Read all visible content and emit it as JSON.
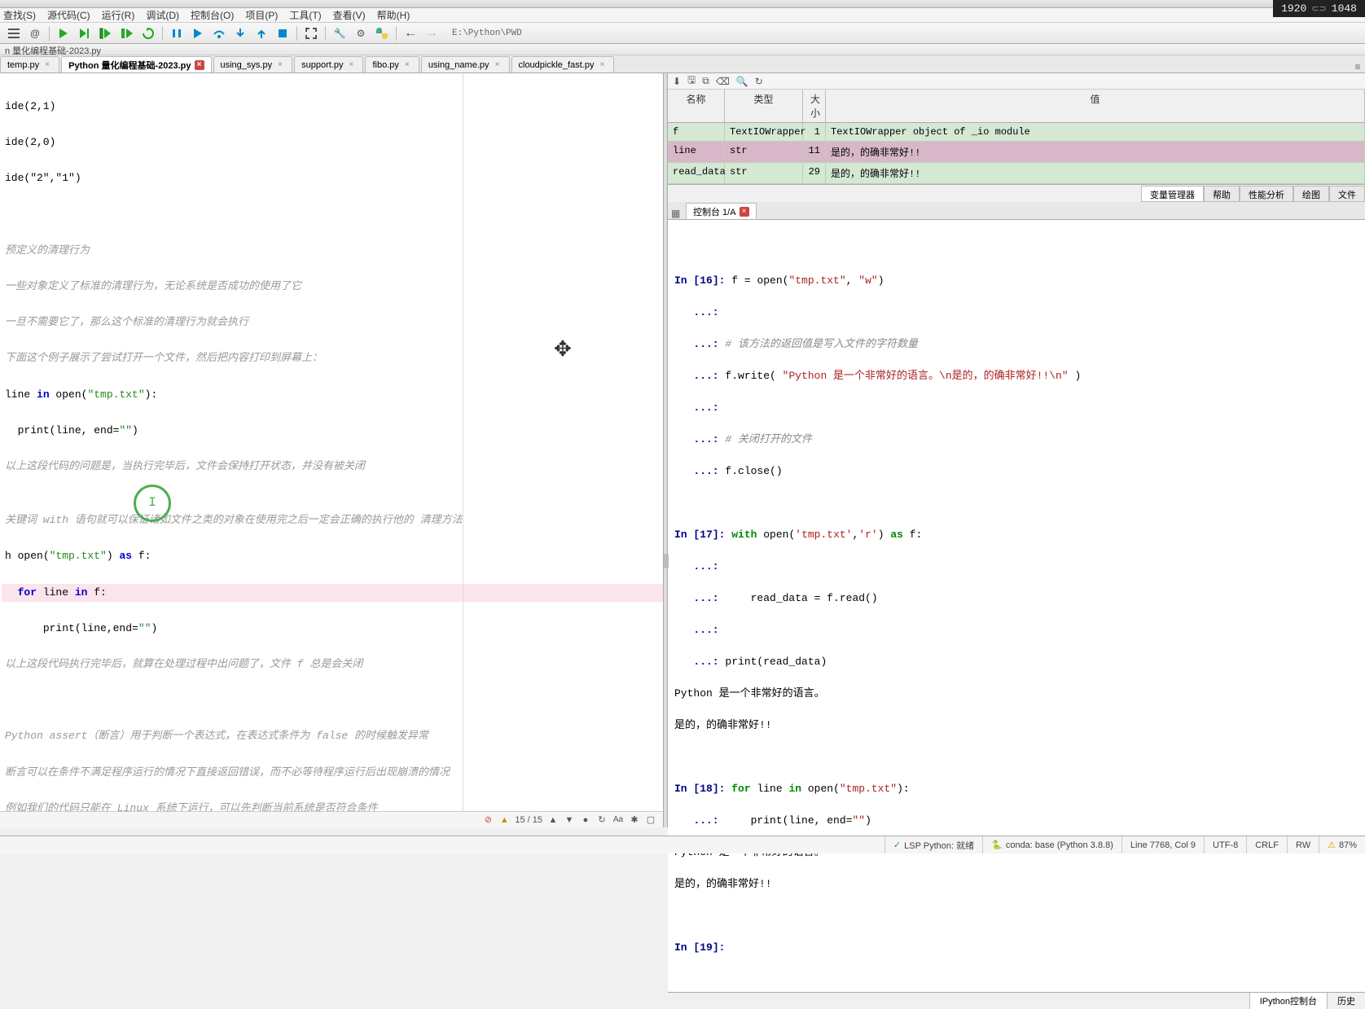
{
  "resBadge": {
    "w": "1920",
    "link": "⊂⊃",
    "h": "1048"
  },
  "menus": {
    "m0": "查找(S)",
    "m1": "源代码(C)",
    "m2": "运行(R)",
    "m3": "调试(D)",
    "m4": "控制台(O)",
    "m5": "项目(P)",
    "m6": "工具(T)",
    "m7": "查看(V)",
    "m8": "帮助(H)"
  },
  "address": "E:\\Python\\PWD",
  "titleText": "n 量化编程基础-2023.py",
  "tabs": {
    "t0": "temp.py",
    "t1": "Python 量化编程基础-2023.py",
    "t2": "using_sys.py",
    "t3": "support.py",
    "t4": "fibo.py",
    "t5": "using_name.py",
    "t6": "cloudpickle_fast.py"
  },
  "code": {
    "l1": "ide(2,1)",
    "l2": "ide(2,0)",
    "l3": "ide(\"2\",\"1\")",
    "l4": "预定义的清理行为",
    "l5": "一些对象定义了标准的清理行为，无论系统是否成功的使用了它",
    "l6": "一旦不需要它了，那么这个标准的清理行为就会执行",
    "l7": "下面这个例子展示了尝试打开一个文件，然后把内容打印到屏幕上：",
    "l8a": "line ",
    "l8b": "in",
    "l8c": " open(",
    "l8d": "\"tmp.txt\"",
    "l8e": "):",
    "l9a": "print(line, end=",
    "l9b": "\"\"",
    "l9c": ")",
    "l10": "以上这段代码的问题是，当执行完毕后，文件会保持打开状态，并没有被关闭",
    "l11": "关键词 with 语句就可以保证诸如文件之类的对象在使用完之后一定会正确的执行他的 清理方法",
    "l12a": "h ",
    "l12b": "open(",
    "l12c": "\"tmp.txt\"",
    "l12d": ") ",
    "l12e": "as",
    "l12f": " f:",
    "l13a": "for",
    "l13b": " line ",
    "l13c": "in",
    "l13d": " f:",
    "l14a": "print(line,end=",
    "l14b": "\"\"",
    "l14c": ")",
    "l15": "以上这段代码执行完毕后，就算在处理过程中出问题了，文件 f 总是会关闭",
    "l16": "Python assert（断言）用于判断一个表达式，在表达式条件为 false 的时候触发异常",
    "l17": "断言可以在条件不满足程序运行的情况下直接返回错误，而不必等待程序运行后出现崩溃的情况",
    "l18": "例如我们的代码只能在 Linux 系统下运行，可以先判断当前系统是否符合条件"
  },
  "editorStatus": {
    "counter": "15 / 15"
  },
  "varHeaders": {
    "name": "名称",
    "type": "类型",
    "size": "大小",
    "value": "值"
  },
  "vars": {
    "r0": {
      "name": "f",
      "type": "TextIOWrapper",
      "size": "1",
      "value": "TextIOWrapper object of _io module"
    },
    "r1": {
      "name": "line",
      "type": "str",
      "size": "11",
      "value": "是的，的确非常好!!"
    },
    "r2": {
      "name": "read_data",
      "type": "str",
      "size": "29",
      "value": "是的，的确非常好!!"
    }
  },
  "varTabs": {
    "t0": "变量管理器",
    "t1": "帮助",
    "t2": "性能分析",
    "t3": "绘图",
    "t4": "文件"
  },
  "consoleTab": "控制台 1/A",
  "console": {
    "p16": "16",
    "l16": "f = open(",
    "l16s1": "\"tmp.txt\"",
    "l16c": ", ",
    "l16s2": "\"w\"",
    "l16e": ")",
    "cont": "   ...: ",
    "c1": "# 该方法的返回值是写入文件的字符数量",
    "l16b": "f.write( ",
    "l16bs": "\"Python 是一个非常好的语言。\\n是的，的确非常好!!\\n\"",
    "l16be": " )",
    "c2": "# 关闭打开的文件",
    "l16d": "f.close()",
    "p17": "17",
    "l17a": "with",
    "l17b": " open(",
    "l17s1": "'tmp.txt'",
    "l17c": ",",
    "l17s2": "'r'",
    "l17d": ") ",
    "l17e": "as",
    "l17f": " f:",
    "l17g": "    read_data = f.read()",
    "l17h": "print(read_data)",
    "out1": "Python 是一个非常好的语言。",
    "out2": "是的，的确非常好!!",
    "p18": "18",
    "l18a": "for",
    "l18b": " line ",
    "l18c": "in",
    "l18d": " open(",
    "l18s": "\"tmp.txt\"",
    "l18e": "):",
    "l18f": "    print(line, end=",
    "l18fs": "\"\"",
    "l18fe": ")",
    "p19": "19"
  },
  "consoleTabs": {
    "t0": "IPython控制台",
    "t1": "历史"
  },
  "status": {
    "lsp": "LSP Python: 就绪",
    "conda": "conda: base (Python 3.8.8)",
    "line": "Line 7768, Col 9",
    "enc": "UTF-8",
    "eol": "CRLF",
    "rw": "RW",
    "mem": "87%"
  }
}
